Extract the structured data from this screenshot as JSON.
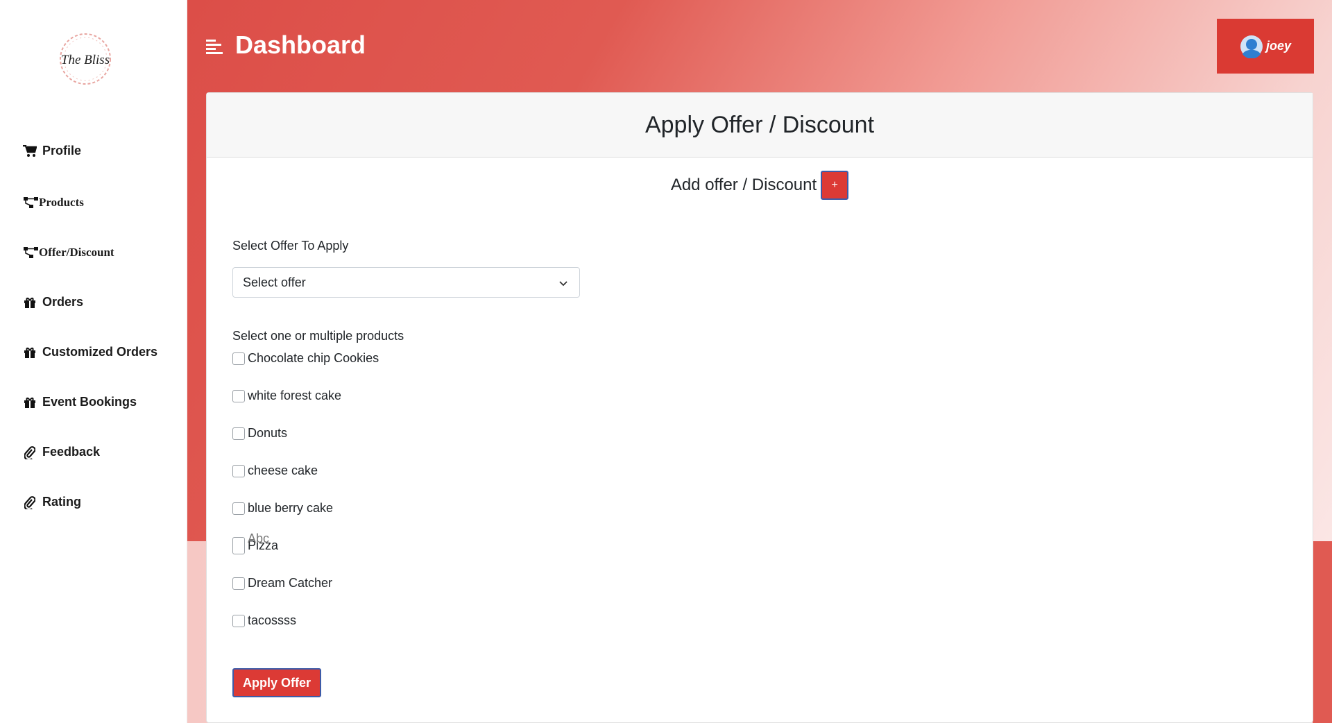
{
  "brand": {
    "logo_text": "The Bliss"
  },
  "sidebar": {
    "items": [
      {
        "label": "Profile",
        "icon": "cart-icon"
      },
      {
        "label": "Products",
        "icon": "sitemap-icon"
      },
      {
        "label": "Offer/Discount",
        "icon": "sitemap-icon"
      },
      {
        "label": "Orders",
        "icon": "gift-icon"
      },
      {
        "label": "Customized Orders",
        "icon": "gift-icon"
      },
      {
        "label": "Event Bookings",
        "icon": "gift-icon"
      },
      {
        "label": "Feedback",
        "icon": "paperclip-icon"
      },
      {
        "label": "Rating",
        "icon": "paperclip-icon"
      }
    ]
  },
  "header": {
    "title": "Dashboard",
    "menu_icon": "menu-icon"
  },
  "user": {
    "name": "joey",
    "icon": "user-avatar-icon"
  },
  "card": {
    "title": "Apply Offer / Discount",
    "add_label": "Add offer / Discount",
    "add_button": "+",
    "select_label": "Select Offer To Apply",
    "select_value": "Select offer",
    "products_label": "Select one or multiple products",
    "products": [
      "Chocolate chip Cookies",
      "white forest cake",
      "Donuts",
      "cheese cake",
      "blue berry cake",
      "Pizza",
      "Dream Catcher",
      "tacossss"
    ],
    "overlapped_product": "Abc",
    "apply_button": "Apply Offer"
  },
  "colors": {
    "accent": "#dc3a35",
    "border_accent": "#3d5ba8",
    "header_start": "#dc4e48"
  }
}
